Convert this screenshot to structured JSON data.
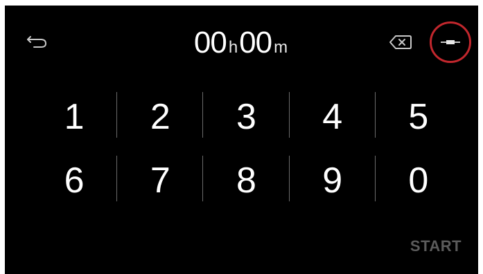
{
  "timer": {
    "hours": "00",
    "hours_unit": "h",
    "minutes": "00",
    "minutes_unit": "m"
  },
  "keypad": {
    "row1": [
      "1",
      "2",
      "3",
      "4",
      "5"
    ],
    "row2": [
      "6",
      "7",
      "8",
      "9",
      "0"
    ]
  },
  "actions": {
    "start_label": "START"
  },
  "icons": {
    "back": "back-arrow-icon",
    "backspace": "backspace-icon",
    "minimize": "minimize-icon"
  },
  "colors": {
    "background": "#000000",
    "text": "#ffffff",
    "start_disabled": "#5b5b5b",
    "highlight_ring": "#c2272d",
    "divider": "#6b6b6b",
    "icon": "#c9c9c9"
  }
}
